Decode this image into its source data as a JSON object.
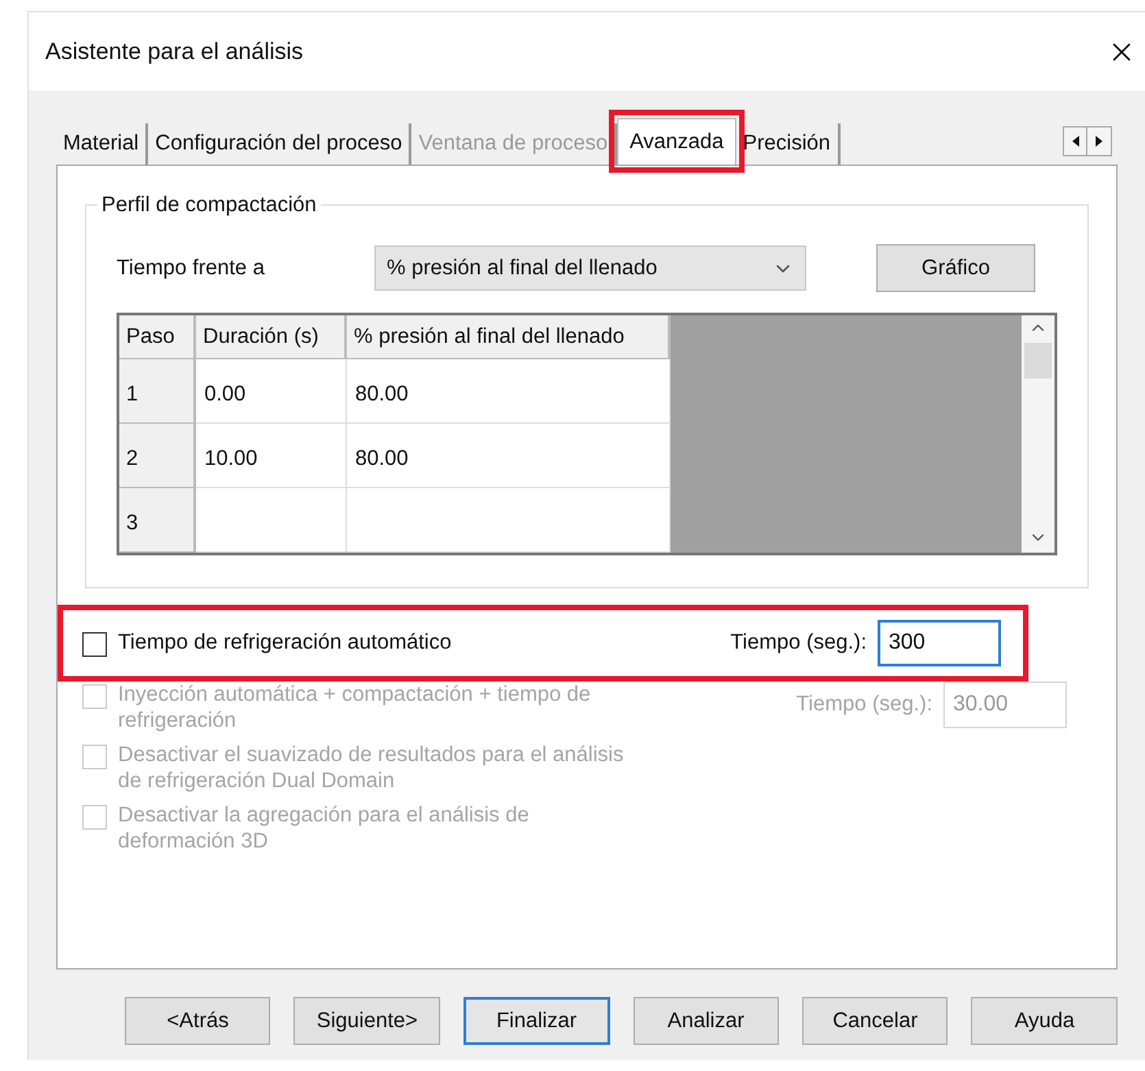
{
  "window": {
    "title": "Asistente para el análisis"
  },
  "tabs": [
    {
      "label": "Material",
      "selected": false,
      "disabled": false,
      "highlighted": false
    },
    {
      "label": "Configuración del proceso",
      "selected": false,
      "disabled": false,
      "highlighted": false
    },
    {
      "label": "Ventana de proceso",
      "selected": false,
      "disabled": true,
      "highlighted": false
    },
    {
      "label": "Avanzada",
      "selected": true,
      "disabled": false,
      "highlighted": true
    },
    {
      "label": "Precisión",
      "selected": false,
      "disabled": false,
      "highlighted": false
    }
  ],
  "group": {
    "title": "Perfil de compactación",
    "time_label": "Tiempo frente a",
    "dropdown": {
      "value": "% presión al final del llenado"
    },
    "graph_button": "Gráfico",
    "table": {
      "columns": [
        "Paso",
        "Duración (s)",
        "% presión al final del llenado"
      ],
      "rows": [
        [
          "1",
          "0.00",
          "80.00"
        ],
        [
          "2",
          "10.00",
          "80.00"
        ],
        [
          "3",
          "",
          ""
        ]
      ]
    }
  },
  "options": [
    {
      "label": "Tiempo de refrigeración automático",
      "checked": false,
      "disabled": false,
      "highlighted": true,
      "time": {
        "label": "Tiempo (seg.):",
        "value": "300",
        "disabled": false
      }
    },
    {
      "label": "Inyección automática + compactación + tiempo de refrigeración",
      "checked": false,
      "disabled": true,
      "highlighted": false,
      "time": {
        "label": "Tiempo (seg.):",
        "value": "30.00",
        "disabled": true
      }
    },
    {
      "label": "Desactivar el suavizado de resultados para el análisis de refrigeración Dual Domain",
      "checked": false,
      "disabled": true,
      "highlighted": false
    },
    {
      "label": "Desactivar la agregación para el análisis de deformación 3D",
      "checked": false,
      "disabled": true,
      "highlighted": false
    }
  ],
  "buttons": [
    {
      "label": "<Atrás",
      "focused": false
    },
    {
      "label": "Siguiente>",
      "focused": false
    },
    {
      "label": "Finalizar",
      "focused": true
    },
    {
      "label": "Analizar",
      "focused": false
    },
    {
      "label": "Cancelar",
      "focused": false
    },
    {
      "label": "Ayuda",
      "focused": false
    }
  ]
}
